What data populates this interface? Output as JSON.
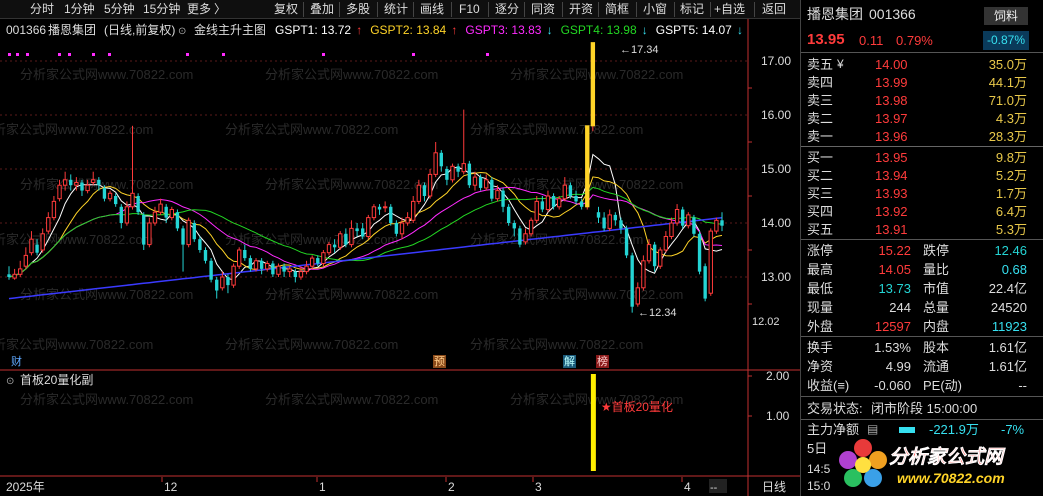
{
  "toolbar": {
    "left": [
      "分时",
      "1分钟",
      "5分钟",
      "15分钟",
      "更多"
    ],
    "more_arrow": "〉",
    "mid": [
      "复权",
      "叠加",
      "多股",
      "统计",
      "画线",
      "F10",
      "逐分",
      "同资",
      "开资",
      "简框",
      "小窗",
      "标记",
      "+自选",
      "返回"
    ]
  },
  "chart": {
    "header_code": "001366",
    "header_name": "播恩集团",
    "header_period": "(日线,前复权)",
    "header_formula": "金线主升主图",
    "legend": [
      {
        "label": "GSPT1: 13.72",
        "arrow": "↑",
        "color": "#ffffff"
      },
      {
        "label": "GSPT2: 13.84",
        "arrow": "↑",
        "color": "#ffd428"
      },
      {
        "label": "GSPT3: 13.83",
        "arrow": "↓",
        "color": "#ff2bff"
      },
      {
        "label": "GSPT4: 13.98",
        "arrow": "↓",
        "color": "#23d723"
      },
      {
        "label": "GSPT5: 14.07",
        "arrow": "↓",
        "color": "#ffffff"
      }
    ],
    "high_label": "17.34",
    "low_label": "12.34",
    "price_tag": "12.02",
    "event_labels": {
      "cai": "财",
      "yu": "预",
      "jie": "解",
      "bang": "榜"
    },
    "sub_title": "首板20量化副",
    "sub_signal_label": "★首板20量化",
    "x_axis": {
      "year": "2025年",
      "m12": "12",
      "m1": "1",
      "m2": "2",
      "m3": "3",
      "m4": "4",
      "period": "日线",
      "dash": "--"
    }
  },
  "chart_data": {
    "type": "candlestick",
    "y_ticks": [
      "17.00",
      "16.00",
      "15.00",
      "14.00",
      "13.00"
    ],
    "ylim": [
      12.0,
      17.6
    ],
    "sub_y_ticks": [
      "2.00",
      "1.00"
    ],
    "sub_ylim": [
      0,
      2.5
    ],
    "sub_signal": {
      "value": 2.0
    },
    "candles": [
      [
        13.05,
        13.0,
        13.2,
        12.95
      ],
      [
        12.98,
        13.05,
        13.15,
        12.95
      ],
      [
        13.05,
        13.15,
        13.3,
        13.0
      ],
      [
        13.2,
        13.4,
        13.55,
        13.15
      ],
      [
        13.45,
        13.7,
        13.85,
        13.4
      ],
      [
        13.6,
        13.45,
        13.7,
        13.4
      ],
      [
        13.5,
        13.8,
        13.9,
        13.45
      ],
      [
        13.85,
        14.1,
        14.2,
        13.8
      ],
      [
        14.1,
        14.4,
        14.5,
        14.05
      ],
      [
        14.45,
        14.7,
        14.8,
        14.4
      ],
      [
        14.7,
        14.8,
        14.95,
        14.6
      ],
      [
        14.8,
        14.7,
        14.9,
        14.6
      ],
      [
        14.7,
        14.75,
        14.85,
        14.6
      ],
      [
        14.75,
        14.6,
        14.8,
        14.5
      ],
      [
        14.6,
        14.7,
        14.8,
        14.55
      ],
      [
        14.75,
        14.8,
        14.95,
        14.7
      ],
      [
        14.8,
        14.7,
        14.85,
        14.6
      ],
      [
        14.65,
        14.45,
        14.7,
        14.4
      ],
      [
        14.45,
        14.55,
        14.6,
        14.4
      ],
      [
        14.5,
        14.35,
        14.55,
        14.3
      ],
      [
        14.3,
        14.0,
        14.35,
        13.9
      ],
      [
        14.0,
        14.3,
        14.4,
        13.95
      ],
      [
        14.3,
        14.55,
        15.8,
        14.25
      ],
      [
        14.5,
        14.2,
        14.55,
        14.15
      ],
      [
        14.15,
        13.6,
        14.2,
        13.5
      ],
      [
        13.6,
        14.0,
        14.1,
        13.55
      ],
      [
        14.0,
        14.2,
        14.3,
        13.95
      ],
      [
        14.2,
        14.35,
        14.45,
        14.15
      ],
      [
        14.3,
        14.1,
        14.35,
        14.0
      ],
      [
        14.1,
        14.25,
        14.3,
        14.05
      ],
      [
        14.2,
        13.9,
        14.25,
        13.85
      ],
      [
        13.9,
        13.6,
        13.95,
        13.1
      ],
      [
        13.6,
        14.05,
        14.1,
        13.55
      ],
      [
        14.0,
        13.7,
        14.05,
        13.65
      ],
      [
        13.7,
        13.5,
        13.75,
        13.45
      ],
      [
        13.5,
        13.3,
        13.55,
        13.25
      ],
      [
        13.3,
        12.95,
        13.35,
        12.9
      ],
      [
        12.95,
        12.75,
        13.0,
        12.6
      ],
      [
        12.8,
        13.0,
        13.1,
        12.75
      ],
      [
        13.0,
        12.85,
        13.05,
        12.7
      ],
      [
        12.85,
        13.2,
        13.25,
        12.8
      ],
      [
        13.2,
        13.5,
        13.55,
        13.15
      ],
      [
        13.5,
        13.35,
        13.6,
        13.3
      ],
      [
        13.35,
        13.15,
        13.4,
        13.1
      ],
      [
        13.15,
        13.3,
        13.35,
        13.1
      ],
      [
        13.3,
        13.15,
        13.35,
        13.05
      ],
      [
        13.15,
        13.25,
        13.3,
        13.1
      ],
      [
        13.25,
        13.05,
        13.3,
        13.0
      ],
      [
        13.05,
        13.2,
        13.25,
        13.0
      ],
      [
        13.2,
        13.1,
        13.25,
        13.0
      ],
      [
        13.1,
        13.15,
        13.2,
        13.0
      ],
      [
        13.1,
        13.0,
        13.15,
        12.9
      ],
      [
        13.0,
        13.1,
        13.2,
        12.95
      ],
      [
        13.1,
        13.2,
        13.3,
        13.05
      ],
      [
        13.2,
        13.35,
        13.4,
        13.15
      ],
      [
        13.35,
        13.25,
        13.4,
        13.2
      ],
      [
        13.25,
        13.45,
        13.5,
        13.2
      ],
      [
        13.45,
        13.6,
        13.65,
        13.4
      ],
      [
        13.6,
        13.55,
        13.7,
        13.45
      ],
      [
        13.55,
        13.8,
        13.85,
        13.5
      ],
      [
        13.8,
        13.6,
        13.9,
        13.55
      ],
      [
        13.6,
        13.9,
        14.05,
        13.55
      ],
      [
        13.9,
        13.85,
        14.0,
        13.75
      ],
      [
        13.9,
        13.75,
        14.0,
        13.7
      ],
      [
        13.75,
        14.1,
        14.15,
        13.7
      ],
      [
        14.1,
        14.3,
        14.35,
        14.05
      ],
      [
        14.3,
        14.25,
        14.35,
        14.15
      ],
      [
        14.3,
        14.3,
        14.4,
        14.2
      ],
      [
        14.3,
        14.0,
        14.35,
        13.95
      ],
      [
        14.0,
        13.8,
        14.05,
        13.75
      ],
      [
        13.8,
        14.0,
        14.1,
        13.7
      ],
      [
        14.0,
        14.1,
        14.2,
        13.95
      ],
      [
        14.05,
        14.4,
        14.5,
        14.0
      ],
      [
        14.4,
        14.7,
        14.8,
        14.35
      ],
      [
        14.7,
        14.5,
        14.75,
        14.4
      ],
      [
        14.5,
        14.9,
        15.0,
        14.45
      ],
      [
        14.9,
        15.3,
        15.5,
        14.85
      ],
      [
        15.3,
        15.05,
        15.35,
        14.95
      ],
      [
        15.0,
        14.8,
        15.05,
        14.7
      ],
      [
        14.8,
        15.05,
        15.1,
        14.75
      ],
      [
        15.05,
        14.95,
        15.1,
        14.85
      ],
      [
        14.95,
        15.1,
        16.1,
        14.9
      ],
      [
        15.1,
        14.7,
        15.15,
        14.65
      ],
      [
        14.7,
        14.85,
        14.95,
        14.6
      ],
      [
        14.85,
        14.65,
        14.9,
        14.6
      ],
      [
        14.65,
        14.8,
        14.9,
        14.6
      ],
      [
        14.8,
        14.45,
        14.85,
        14.4
      ],
      [
        14.45,
        14.6,
        14.7,
        14.4
      ],
      [
        14.6,
        14.3,
        14.65,
        14.2
      ],
      [
        14.3,
        14.0,
        14.35,
        13.95
      ],
      [
        14.0,
        13.9,
        14.05,
        13.75
      ],
      [
        13.9,
        13.6,
        13.95,
        13.55
      ],
      [
        13.65,
        13.8,
        13.9,
        13.6
      ],
      [
        13.8,
        14.05,
        14.1,
        13.75
      ],
      [
        14.05,
        14.4,
        14.5,
        14.0
      ],
      [
        14.4,
        14.25,
        14.5,
        14.2
      ],
      [
        14.25,
        14.5,
        14.6,
        14.2
      ],
      [
        14.5,
        14.3,
        14.55,
        14.25
      ],
      [
        14.3,
        14.45,
        14.5,
        14.25
      ],
      [
        14.45,
        14.7,
        14.85,
        14.4
      ],
      [
        14.7,
        14.5,
        14.75,
        14.45
      ],
      [
        14.5,
        14.4,
        14.6,
        14.35
      ],
      [
        14.4,
        14.3,
        14.45,
        14.25
      ],
      [
        14.3,
        15.8,
        15.8,
        14.25
      ],
      [
        15.8,
        17.34,
        17.34,
        15.7
      ],
      [
        14.2,
        14.1,
        14.3,
        14.0
      ],
      [
        14.1,
        13.9,
        14.2,
        13.85
      ],
      [
        13.9,
        14.15,
        14.25,
        13.85
      ],
      [
        14.15,
        14.05,
        14.2,
        13.95
      ],
      [
        14.05,
        13.9,
        14.1,
        13.8
      ],
      [
        13.9,
        13.4,
        13.95,
        13.35
      ],
      [
        13.4,
        12.45,
        13.45,
        12.34
      ],
      [
        12.5,
        12.8,
        12.9,
        12.45
      ],
      [
        12.8,
        13.3,
        13.4,
        12.75
      ],
      [
        13.3,
        13.6,
        13.7,
        13.25
      ],
      [
        13.6,
        13.2,
        13.65,
        13.1
      ],
      [
        13.2,
        13.5,
        13.55,
        13.15
      ],
      [
        13.5,
        13.75,
        13.85,
        13.45
      ],
      [
        13.75,
        14.0,
        14.1,
        13.7
      ],
      [
        14.0,
        14.25,
        14.35,
        13.95
      ],
      [
        14.25,
        13.95,
        14.3,
        13.9
      ],
      [
        13.95,
        14.15,
        14.2,
        13.9
      ],
      [
        14.1,
        13.8,
        14.15,
        13.75
      ],
      [
        13.8,
        13.1,
        13.85,
        13.05
      ],
      [
        13.2,
        12.6,
        13.25,
        12.55
      ],
      [
        12.7,
        13.85,
        13.9,
        12.65
      ],
      [
        13.85,
        14.05,
        14.1,
        13.8
      ],
      [
        14.05,
        13.95,
        14.2,
        13.85
      ]
    ]
  },
  "watermark": "分析家公式网www.70822.com",
  "quote": {
    "name": "播恩集团",
    "code": "001366",
    "badge": "饲料",
    "last": "13.95",
    "change": "0.11",
    "pct": "0.79%",
    "weibi": "-0.87%",
    "asks": [
      {
        "label": "卖五",
        "mark": "¥",
        "price": "14.00",
        "vol": "35.0万"
      },
      {
        "label": "卖四",
        "mark": "",
        "price": "13.99",
        "vol": "44.1万"
      },
      {
        "label": "卖三",
        "mark": "",
        "price": "13.98",
        "vol": "71.0万"
      },
      {
        "label": "卖二",
        "mark": "",
        "price": "13.97",
        "vol": "4.3万"
      },
      {
        "label": "卖一",
        "mark": "",
        "price": "13.96",
        "vol": "28.3万"
      }
    ],
    "bids": [
      {
        "label": "买一",
        "price": "13.95",
        "vol": "9.8万"
      },
      {
        "label": "买二",
        "price": "13.94",
        "vol": "5.2万"
      },
      {
        "label": "买三",
        "price": "13.93",
        "vol": "1.7万"
      },
      {
        "label": "买四",
        "price": "13.92",
        "vol": "6.4万"
      },
      {
        "label": "买五",
        "price": "13.91",
        "vol": "5.3万"
      }
    ],
    "stats": [
      {
        "l1": "涨停",
        "v1": "15.22",
        "c1": "red",
        "l2": "跌停",
        "v2": "12.46",
        "c2": "grn"
      },
      {
        "l1": "最高",
        "v1": "14.05",
        "c1": "red",
        "l2": "量比",
        "v2": "0.68",
        "c2": "cy"
      },
      {
        "l1": "最低",
        "v1": "13.73",
        "c1": "grn",
        "l2": "市值",
        "v2": "22.4亿",
        "c2": "wht"
      },
      {
        "l1": "现量",
        "v1": "244",
        "c1": "wht",
        "l2": "总量",
        "v2": "24520",
        "c2": "wht"
      },
      {
        "l1": "外盘",
        "v1": "12597",
        "c1": "red",
        "l2": "内盘",
        "v2": "11923",
        "c2": "cy"
      }
    ],
    "fin": [
      {
        "l1": "换手",
        "v1": "1.53%",
        "l2": "股本",
        "v2": "1.61亿"
      },
      {
        "l1": "净资",
        "v1": "4.99",
        "l2": "流通",
        "v2": "1.61亿"
      },
      {
        "l1": "收益(≡)",
        "v1": "-0.060",
        "l2": "PE(动)",
        "v2": "--"
      }
    ],
    "status_label": "交易状态:",
    "status_value": "闭市阶段 15:00:00",
    "flow_label": "主力净额",
    "flow_icon": "▤",
    "flow_value": "-221.9万",
    "flow_pct": "-7%",
    "day_label": "5日",
    "time1": "14:5",
    "time2": "15:0",
    "logo_text": "分析家公式网",
    "logo_url": "www.70822.com"
  }
}
